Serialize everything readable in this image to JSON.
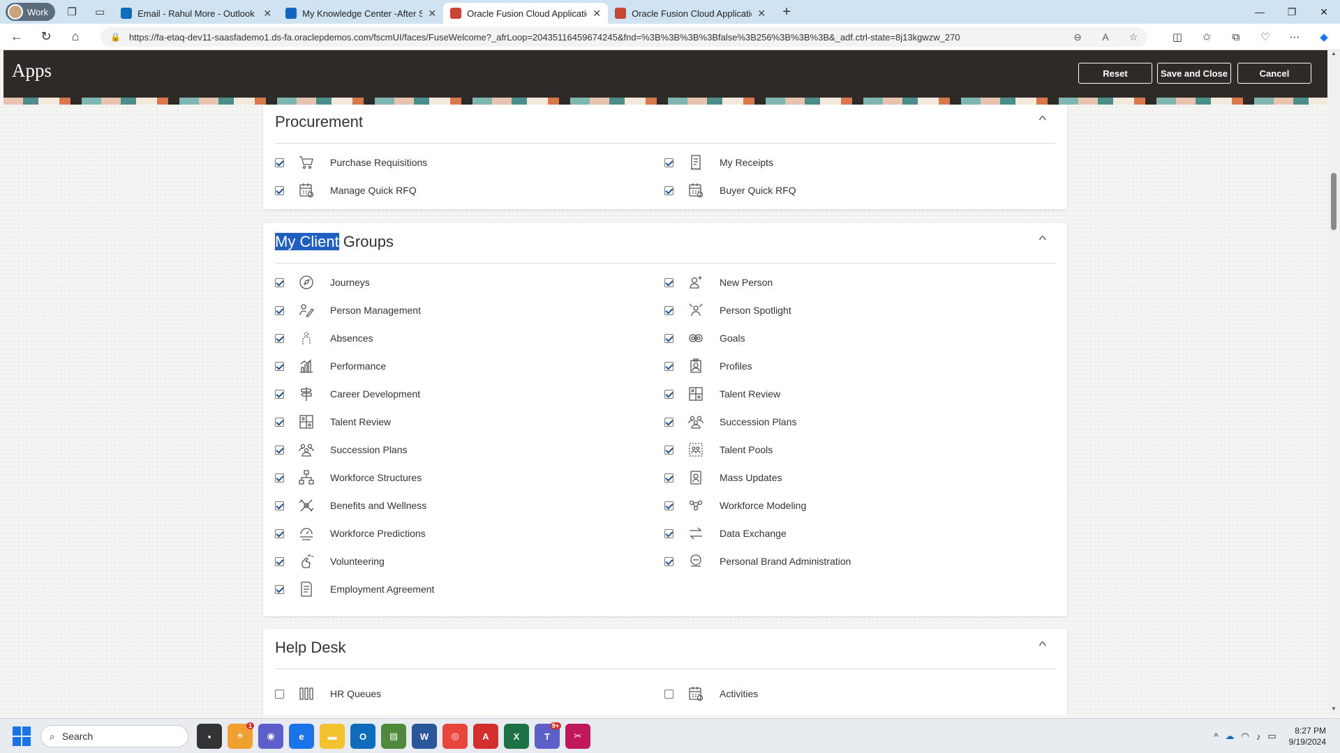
{
  "browser": {
    "profile": "Work",
    "tabs": [
      {
        "title": "Email - Rahul More - Outlook",
        "color": "#0f6cbd",
        "active": false
      },
      {
        "title": "My Knowledge Center -After SE G",
        "color": "#1565c0",
        "active": false
      },
      {
        "title": "Oracle Fusion Cloud Applications",
        "color": "#c74634",
        "active": true
      },
      {
        "title": "Oracle Fusion Cloud Applications",
        "color": "#c74634",
        "active": false
      }
    ],
    "url": "https://fa-etaq-dev11-saasfademo1.ds-fa.oraclepdemos.com/fscmUI/faces/FuseWelcome?_afrLoop=20435116459674245&fnd=%3B%3B%3B%3Bfalse%3B256%3B%3B%3B&_adf.ctrl-state=8j13kgwzw_270"
  },
  "header": {
    "title": "Apps",
    "reset_label": "Reset",
    "save_label": "Save and Close",
    "cancel_label": "Cancel"
  },
  "sections": {
    "procurement": {
      "title": "Procurement",
      "items": [
        {
          "label": "Purchase Requisitions",
          "checked": true,
          "icon": "cart-icon"
        },
        {
          "label": "My Receipts",
          "checked": true,
          "icon": "receipt-icon"
        },
        {
          "label": "Manage Quick RFQ",
          "checked": true,
          "icon": "calendar-icon"
        },
        {
          "label": "Buyer Quick RFQ",
          "checked": true,
          "icon": "calendar-icon"
        }
      ]
    },
    "client_groups": {
      "title_highlight": "My Client",
      "title_rest": " Groups",
      "items": [
        {
          "label": "Journeys",
          "checked": true,
          "icon": "compass-icon"
        },
        {
          "label": "New Person",
          "checked": true,
          "icon": "new-person-icon"
        },
        {
          "label": "Person Management",
          "checked": true,
          "icon": "person-edit-icon"
        },
        {
          "label": "Person Spotlight",
          "checked": true,
          "icon": "spotlight-icon"
        },
        {
          "label": "Absences",
          "checked": true,
          "icon": "absence-icon"
        },
        {
          "label": "Goals",
          "checked": true,
          "icon": "target-icon"
        },
        {
          "label": "Performance",
          "checked": true,
          "icon": "bar-chart-icon"
        },
        {
          "label": "Profiles",
          "checked": true,
          "icon": "profile-icon"
        },
        {
          "label": "Career Development",
          "checked": true,
          "icon": "signpost-icon"
        },
        {
          "label": "Talent Review",
          "checked": true,
          "icon": "grid-icon"
        },
        {
          "label": "Talent Review",
          "checked": true,
          "icon": "grid-icon"
        },
        {
          "label": "Succession Plans",
          "checked": true,
          "icon": "group-icon"
        },
        {
          "label": "Succession Plans",
          "checked": true,
          "icon": "group-icon"
        },
        {
          "label": "Talent Pools",
          "checked": true,
          "icon": "pool-icon"
        },
        {
          "label": "Workforce Structures",
          "checked": true,
          "icon": "hierarchy-icon"
        },
        {
          "label": "Mass Updates",
          "checked": true,
          "icon": "mass-update-icon"
        },
        {
          "label": "Benefits and Wellness",
          "checked": true,
          "icon": "wellness-icon"
        },
        {
          "label": "Workforce Modeling",
          "checked": true,
          "icon": "modeling-icon"
        },
        {
          "label": "Workforce Predictions",
          "checked": true,
          "icon": "prediction-icon"
        },
        {
          "label": "Data Exchange",
          "checked": true,
          "icon": "exchange-icon"
        },
        {
          "label": "Volunteering",
          "checked": true,
          "icon": "volunteer-icon"
        },
        {
          "label": "Personal Brand Administration",
          "checked": true,
          "icon": "brand-icon"
        },
        {
          "label": "Employment Agreement",
          "checked": true,
          "icon": "document-icon"
        }
      ]
    },
    "help_desk": {
      "title": "Help Desk",
      "items": [
        {
          "label": "HR Queues",
          "checked": false,
          "icon": "queue-icon"
        },
        {
          "label": "Activities",
          "checked": false,
          "icon": "calendar-icon"
        }
      ]
    }
  },
  "taskbar": {
    "search_placeholder": "Search",
    "time": "8:27 PM",
    "date": "9/19/2024"
  }
}
